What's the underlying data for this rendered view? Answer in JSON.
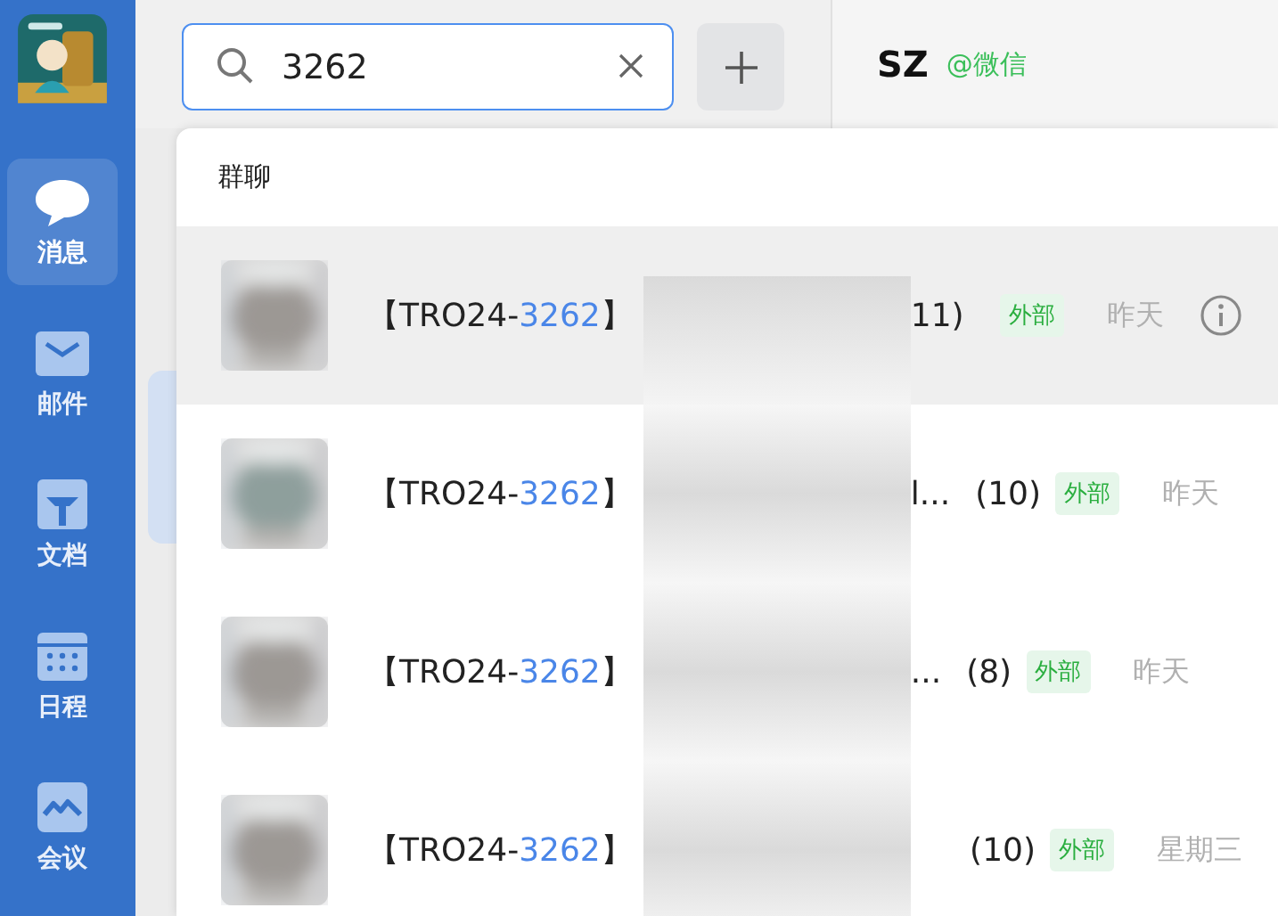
{
  "sidebar": {
    "items": [
      {
        "kind": "chat",
        "label": "消息",
        "selected": true
      },
      {
        "kind": "mail",
        "label": "邮件",
        "selected": false
      },
      {
        "kind": "doc",
        "label": "文档",
        "selected": false
      },
      {
        "kind": "calendar",
        "label": "日程",
        "selected": false
      },
      {
        "kind": "meeting",
        "label": "会议",
        "selected": false
      }
    ]
  },
  "search": {
    "value": "3262"
  },
  "header": {
    "name": "SZ",
    "source": "@微信"
  },
  "results": {
    "section": "群聊",
    "rows": [
      {
        "prefix": "【TRO24-",
        "match": "3262",
        "suffix": "】",
        "tail": "11)",
        "tag": "外部",
        "time": "昨天",
        "hovered": true
      },
      {
        "prefix": "【TRO24-",
        "match": "3262",
        "suffix": "】",
        "tail": "l...",
        "count": "(10)",
        "tag": "外部",
        "time": "昨天",
        "hovered": false
      },
      {
        "prefix": "【TRO24-",
        "match": "3262",
        "suffix": "】",
        "tail": "...",
        "count": "(8)",
        "tag": "外部",
        "time": "昨天",
        "hovered": false
      },
      {
        "prefix": "【TRO24-",
        "match": "3262",
        "suffix": "】",
        "count": "(10)",
        "tag": "外部",
        "time": "星期三",
        "hovered": false
      }
    ]
  }
}
